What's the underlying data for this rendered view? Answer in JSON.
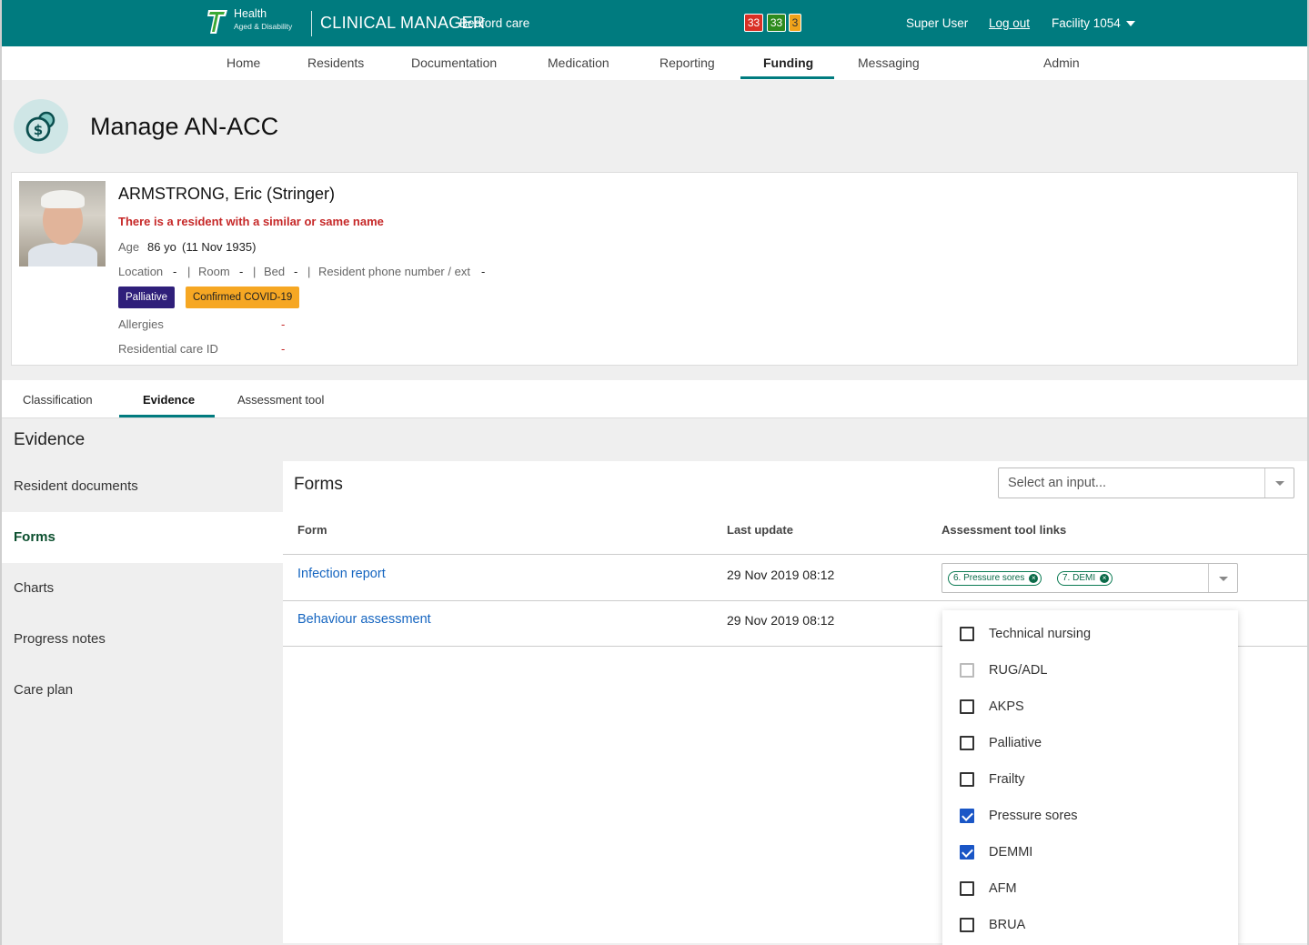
{
  "topbar": {
    "brand_line1": "Health",
    "brand_line2": "Aged & Disability",
    "app_name": "CLINICAL MANAGER",
    "facility_name": "Bedford care",
    "counters": {
      "red": "33",
      "green": "33",
      "amber": "3"
    },
    "user": "Super User",
    "logout": "Log out",
    "facility": "Facility 1054",
    "colors": {
      "bar": "#007b7f",
      "red": "#d93025",
      "green": "#2e8b1e",
      "amber": "#f0a31b"
    }
  },
  "nav": {
    "items": [
      "Home",
      "Residents",
      "Documentation",
      "Medication",
      "Reporting",
      "Funding",
      "Messaging",
      "Admin"
    ],
    "active": "Funding"
  },
  "page": {
    "title": "Manage AN-ACC",
    "icon": "funding-coins-icon"
  },
  "resident": {
    "name": "ARMSTRONG, Eric (Stringer)",
    "warning": "There is a resident with a similar or same name",
    "age_label": "Age",
    "age_value": "86 yo",
    "dob": "(11 Nov 1935)",
    "location_label": "Location",
    "location_value": "-",
    "room_label": "Room",
    "room_value": "-",
    "bed_label": "Bed",
    "bed_value": "-",
    "phone_label": "Resident phone number / ext",
    "phone_value": "-",
    "sep": "|",
    "badges": [
      "Palliative",
      "Confirmed COVID-19"
    ],
    "allergies_label": "Allergies",
    "allergies_value": "-",
    "care_id_label": "Residential care ID",
    "care_id_value": "-"
  },
  "tabs": {
    "items": [
      "Classification",
      "Evidence",
      "Assessment tool"
    ],
    "active": "Evidence"
  },
  "evidence": {
    "title": "Evidence",
    "menu": [
      "Resident documents",
      "Forms",
      "Charts",
      "Progress notes",
      "Care plan"
    ],
    "active": "Forms"
  },
  "forms": {
    "title": "Forms",
    "select_placeholder": "Select an input...",
    "columns": [
      "Form",
      "Last update",
      "Assessment tool links"
    ],
    "rows": [
      {
        "form": "Infection report",
        "updated": "29 Nov 2019 08:12",
        "links": [
          "6. Pressure sores",
          "7. DEMI"
        ]
      },
      {
        "form": "Behaviour assessment",
        "updated": "29 Nov 2019 08:12",
        "links": []
      }
    ]
  },
  "dropdown": {
    "options": [
      {
        "label": "Technical nursing",
        "checked": false
      },
      {
        "label": "RUG/ADL",
        "checked": false
      },
      {
        "label": "AKPS",
        "checked": false
      },
      {
        "label": "Palliative",
        "checked": false
      },
      {
        "label": "Frailty",
        "checked": false
      },
      {
        "label": "Pressure sores",
        "checked": true
      },
      {
        "label": "DEMMI",
        "checked": true
      },
      {
        "label": "AFM",
        "checked": false
      },
      {
        "label": "BRUA",
        "checked": false
      }
    ]
  }
}
